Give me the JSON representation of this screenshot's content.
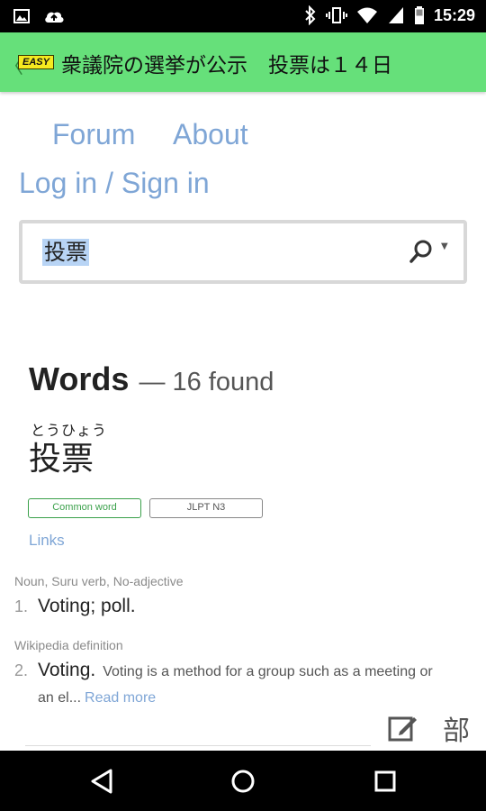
{
  "status_bar": {
    "time": "15:29",
    "left_icons": [
      "image-icon",
      "cloud-upload-icon"
    ],
    "right_icons": [
      "bluetooth-icon",
      "vibrate-icon",
      "wifi-icon",
      "cell-signal-icon",
      "battery-icon"
    ]
  },
  "banner": {
    "easy_label": "EASY",
    "headline": "衆議院の選挙が公示　投票は１４日"
  },
  "nav": {
    "forum": "Forum",
    "about": "About",
    "login": "Log in / Sign in"
  },
  "search": {
    "query": "投票"
  },
  "results": {
    "heading": "Words",
    "count_text": "— 16 found",
    "entry": {
      "furigana": "とうひょう",
      "word": "投票",
      "tags": [
        "Common word",
        "JLPT N3"
      ],
      "links_label": "Links",
      "meanings": [
        {
          "pos": "Noun, Suru verb, No-adjective",
          "number": "1.",
          "definition": "Voting; poll."
        },
        {
          "pos": "Wikipedia definition",
          "number": "2.",
          "definition": "Voting.",
          "sentence_start": "Voting is a method for a group such as a meeting or",
          "sentence_end": "an el...",
          "read_more": "Read more"
        }
      ]
    }
  },
  "fab": {
    "radical_label": "部"
  },
  "colors": {
    "banner": "#66e07a",
    "link": "#7fa6d6",
    "common_tag": "#3aa04a",
    "selection": "#b8d4f5"
  }
}
